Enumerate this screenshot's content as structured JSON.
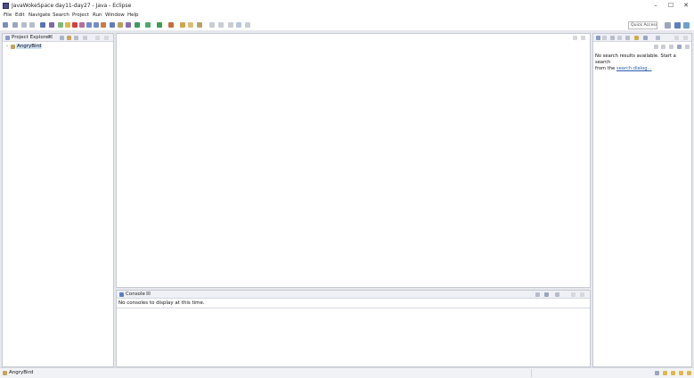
{
  "window": {
    "title": "JavaWokeSpace day11-day27 - Java - Eclipse",
    "minimize": "–",
    "maximize": "☐",
    "close": "✕"
  },
  "menu": [
    "File",
    "Edit",
    "Navigate",
    "Search",
    "Project",
    "Run",
    "Window",
    "Help"
  ],
  "toolbar": {
    "quick_access": "Quick Access"
  },
  "project_explorer": {
    "tab_label": "Project Explorer",
    "tab_close": "☒",
    "items": [
      {
        "label": "AngryBird"
      }
    ]
  },
  "search_view": {
    "message": "No search results available. Start a search",
    "message_cont": "from the ",
    "link": "search dialog...",
    "link_tail": ""
  },
  "console": {
    "tab_label": "Console",
    "tab_close": "☒",
    "message": "No consoles to display at this time."
  },
  "statusbar": {
    "selected": "AngryBird"
  },
  "colors": {
    "accent": "#2a5db0",
    "frame_bg": "#e6e8ee",
    "tab_bg": "#eef0f5"
  }
}
